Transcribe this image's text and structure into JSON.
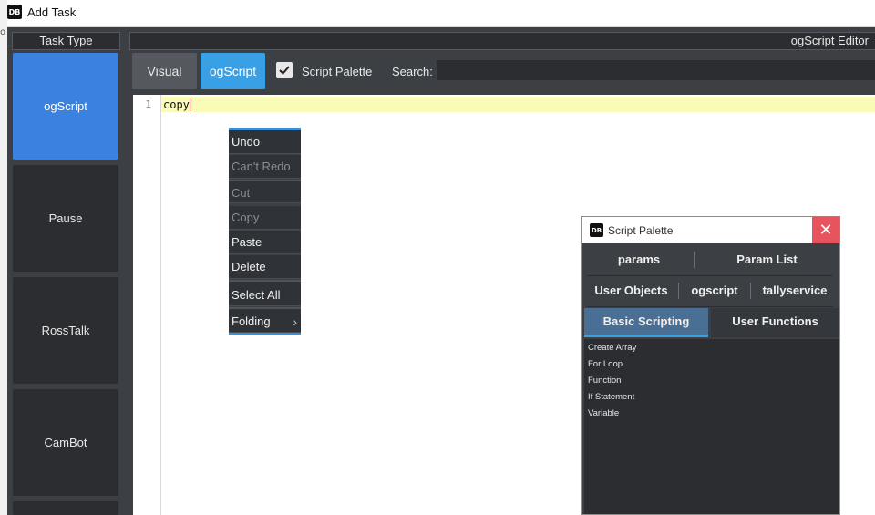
{
  "window": {
    "title": "Add Task",
    "icon_text": "DB"
  },
  "desktop": {
    "edge_text": "o"
  },
  "task_type": {
    "header": "Task Type",
    "items": [
      "ogScript",
      "Pause",
      "RossTalk",
      "CamBot"
    ],
    "active": "ogScript"
  },
  "editor": {
    "title": "ogScript Editor",
    "visual_label": "Visual",
    "ogscript_label": "ogScript",
    "palette_label": "Script Palette",
    "palette_checked": true,
    "search_label": "Search:",
    "search_value": "",
    "line_number": "1",
    "code": "copy"
  },
  "context_menu": {
    "items": [
      {
        "label": "Undo",
        "disabled": false
      },
      {
        "label": "Can't Redo",
        "disabled": true
      },
      {
        "label": "Cut",
        "disabled": true
      },
      {
        "label": "Copy",
        "disabled": true
      },
      {
        "label": "Paste",
        "disabled": false
      },
      {
        "label": "Delete",
        "disabled": false
      },
      {
        "label": "Select All",
        "disabled": false
      },
      {
        "label": "Folding",
        "disabled": false,
        "submenu": true
      }
    ]
  },
  "palette": {
    "title": "Script Palette",
    "icon_text": "DB",
    "close_glyph": "✕",
    "tabs_row1": [
      "params",
      "Param List"
    ],
    "tabs_row2": [
      "User Objects",
      "ogscript",
      "tallyservice"
    ],
    "tabs_row3": [
      "Basic Scripting",
      "User Functions"
    ],
    "active_tab": "Basic Scripting",
    "items": [
      "Create Array",
      "For Loop",
      "Function",
      "If Statement",
      "Variable"
    ]
  },
  "colors": {
    "accent_blue": "#3b82e0",
    "ogscript_blue": "#3aa0e6",
    "close_red": "#e8545d",
    "current_line": "#fbfbb8"
  }
}
